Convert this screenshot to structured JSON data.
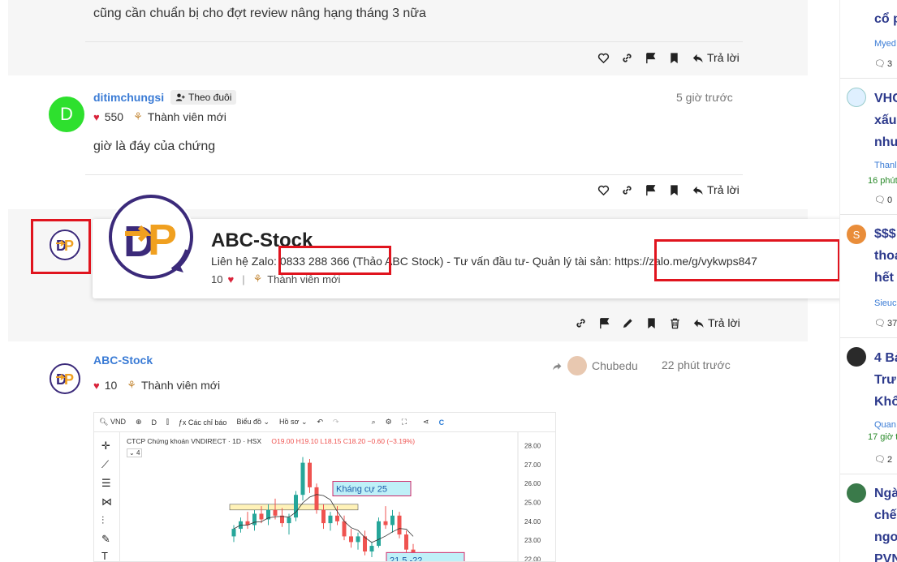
{
  "posts": [
    {
      "content": "cũng cần chuẩn bị cho đợt review nâng hạng tháng 3 nữa",
      "reply_label": "Trả lời"
    },
    {
      "username": "ditimchungsi",
      "avatar_letter": "D",
      "follow_label": "Theo đuôi",
      "time": "5 giờ trước",
      "likes": "550",
      "rank": "Thành viên mới",
      "content": "giờ là đáy của chứng",
      "reply_label": "Trả lời"
    },
    {
      "reply_label": "Trả lời"
    },
    {
      "username": "ABC-Stock",
      "likes": "10",
      "rank": "Thành viên mới",
      "shared_by": "Chubedu",
      "time": "22 phút trước"
    }
  ],
  "profile_card": {
    "name": "ABC-Stock",
    "description": "Liên hệ Zalo: 0833 288 366 (Thảo ABC Stock) - Tư vấn đầu tư- Quản lý tài sản: https://zalo.me/g/vykwps847",
    "likes": "10",
    "rank": "Thành viên mới"
  },
  "chart_toolbar": {
    "symbol": "VND",
    "interval": "D",
    "indicators": "Các chỉ báo",
    "chart_type": "Biểu đồ",
    "profile": "Hồ sơ"
  },
  "chart_data": {
    "type": "candlestick",
    "title": "CTCP Chứng khoán VNDIRECT · 1D · HSX",
    "ohlc_label": "O19.00 H19.10 L18.15 C18.20 −0.60 (−3.19%)",
    "indicator_count": "4",
    "y_ticks": [
      "28.00",
      "27.00",
      "26.00",
      "25.00",
      "24.00",
      "23.00",
      "22.00"
    ],
    "ylim": [
      21.8,
      28.2
    ],
    "annotations": [
      {
        "text": "Kháng cự 25",
        "value": 25.0
      },
      {
        "text": "21.5 -22",
        "value": 22.0
      }
    ],
    "resistance_zone": [
      24.6,
      24.9
    ],
    "candles": [
      {
        "o": 23.2,
        "h": 23.8,
        "l": 22.9,
        "c": 23.6
      },
      {
        "o": 23.6,
        "h": 24.2,
        "l": 23.4,
        "c": 24.0
      },
      {
        "o": 24.0,
        "h": 24.5,
        "l": 23.6,
        "c": 23.8
      },
      {
        "o": 23.8,
        "h": 24.6,
        "l": 23.5,
        "c": 24.4
      },
      {
        "o": 24.4,
        "h": 24.8,
        "l": 23.9,
        "c": 24.1
      },
      {
        "o": 24.1,
        "h": 24.9,
        "l": 23.8,
        "c": 24.6
      },
      {
        "o": 24.6,
        "h": 25.2,
        "l": 24.1,
        "c": 24.3
      },
      {
        "o": 24.3,
        "h": 24.7,
        "l": 23.7,
        "c": 23.9
      },
      {
        "o": 23.9,
        "h": 24.4,
        "l": 23.3,
        "c": 24.2
      },
      {
        "o": 24.2,
        "h": 25.6,
        "l": 24.0,
        "c": 25.4
      },
      {
        "o": 25.4,
        "h": 27.4,
        "l": 25.1,
        "c": 27.1
      },
      {
        "o": 27.1,
        "h": 27.3,
        "l": 25.5,
        "c": 25.8
      },
      {
        "o": 25.8,
        "h": 26.0,
        "l": 24.4,
        "c": 24.6
      },
      {
        "o": 24.6,
        "h": 24.9,
        "l": 23.6,
        "c": 23.9
      },
      {
        "o": 23.9,
        "h": 24.5,
        "l": 23.5,
        "c": 24.3
      },
      {
        "o": 24.3,
        "h": 24.8,
        "l": 23.8,
        "c": 24.0
      },
      {
        "o": 24.0,
        "h": 24.3,
        "l": 23.0,
        "c": 23.2
      },
      {
        "o": 23.2,
        "h": 23.6,
        "l": 22.6,
        "c": 22.9
      },
      {
        "o": 22.9,
        "h": 23.4,
        "l": 22.5,
        "c": 23.2
      },
      {
        "o": 23.2,
        "h": 23.5,
        "l": 22.2,
        "c": 22.4
      },
      {
        "o": 22.4,
        "h": 22.9,
        "l": 22.1,
        "c": 22.7
      },
      {
        "o": 22.7,
        "h": 24.2,
        "l": 22.6,
        "c": 24.0
      },
      {
        "o": 24.0,
        "h": 24.8,
        "l": 23.6,
        "c": 23.8
      },
      {
        "o": 23.8,
        "h": 24.6,
        "l": 23.4,
        "c": 24.3
      },
      {
        "o": 24.3,
        "h": 24.5,
        "l": 23.1,
        "c": 23.3
      },
      {
        "o": 23.3,
        "h": 23.5,
        "l": 22.3,
        "c": 22.5
      },
      {
        "o": 22.5,
        "h": 22.8,
        "l": 21.9,
        "c": 22.1
      }
    ],
    "colors": {
      "up": "#26a69a",
      "down": "#ef5350"
    }
  },
  "sidebar": [
    {
      "title": "cổ p",
      "author": "Myed",
      "count": "3",
      "avatar_color": "#ffffff"
    },
    {
      "title": "VHC",
      "title2": "xấu",
      "title3": "nhu",
      "author": "Thanl",
      "time": "16 phút",
      "count": "0",
      "avatar_color": "#dff0ff"
    },
    {
      "title": "$$$",
      "title2": "thoa",
      "title3": "hết",
      "author": "Sieuc",
      "count": "37",
      "avatar_letter": "S",
      "avatar_color": "#e98d3a"
    },
    {
      "title": "4 Bả",
      "title2": "Trư",
      "title3": "Khổ",
      "author": "Quan",
      "time": "17 giờ t",
      "count": "2",
      "avatar_color": "#2a2a2a"
    },
    {
      "title": "Ngà",
      "title2": "chế",
      "title3": "ngo",
      "title4": "PVN",
      "avatar_color": "#3a7a4a"
    }
  ],
  "colors": {
    "accent": "#3a7bd5",
    "highlight_box": "#e0141e",
    "brand_navy": "#3b2a7a",
    "brand_orange": "#f0a020"
  }
}
